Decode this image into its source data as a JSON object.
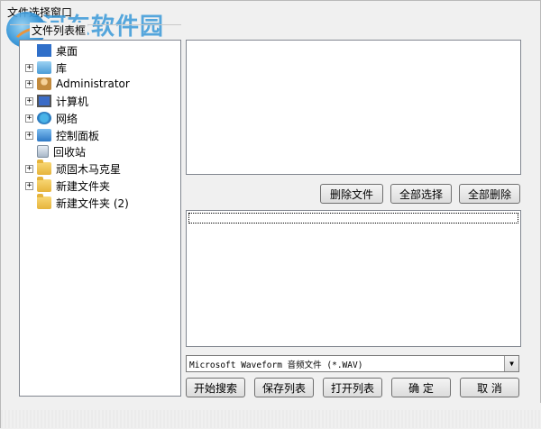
{
  "window": {
    "title": "文件选择窗口"
  },
  "watermark": {
    "site_name": "河东软件园",
    "url": "www.pc0359.cn"
  },
  "tree": {
    "group_label": "文件列表框",
    "items": [
      {
        "label": "桌面",
        "icon": "desktop-icon",
        "expander": ""
      },
      {
        "label": "库",
        "icon": "library-icon",
        "expander": "+"
      },
      {
        "label": "Administrator",
        "icon": "user-folder-icon",
        "expander": "+"
      },
      {
        "label": "计算机",
        "icon": "computer-icon",
        "expander": "+"
      },
      {
        "label": "网络",
        "icon": "network-icon",
        "expander": "+"
      },
      {
        "label": "控制面板",
        "icon": "control-panel-icon",
        "expander": "+"
      },
      {
        "label": "回收站",
        "icon": "recycle-bin-icon",
        "expander": ""
      },
      {
        "label": "顽固木马克星",
        "icon": "folder-icon",
        "expander": "+"
      },
      {
        "label": "新建文件夹",
        "icon": "folder-icon",
        "expander": "+"
      },
      {
        "label": "新建文件夹 (2)",
        "icon": "folder-icon",
        "expander": ""
      }
    ]
  },
  "actions": {
    "delete_file": "删除文件",
    "select_all": "全部选择",
    "delete_all": "全部删除"
  },
  "filter": {
    "selected": "Microsoft Waveform 音频文件 (*.WAV)"
  },
  "footer_buttons": {
    "start_search": "开始搜索",
    "save_list": "保存列表",
    "open_list": "打开列表",
    "ok": "确  定",
    "cancel": "取  消"
  }
}
